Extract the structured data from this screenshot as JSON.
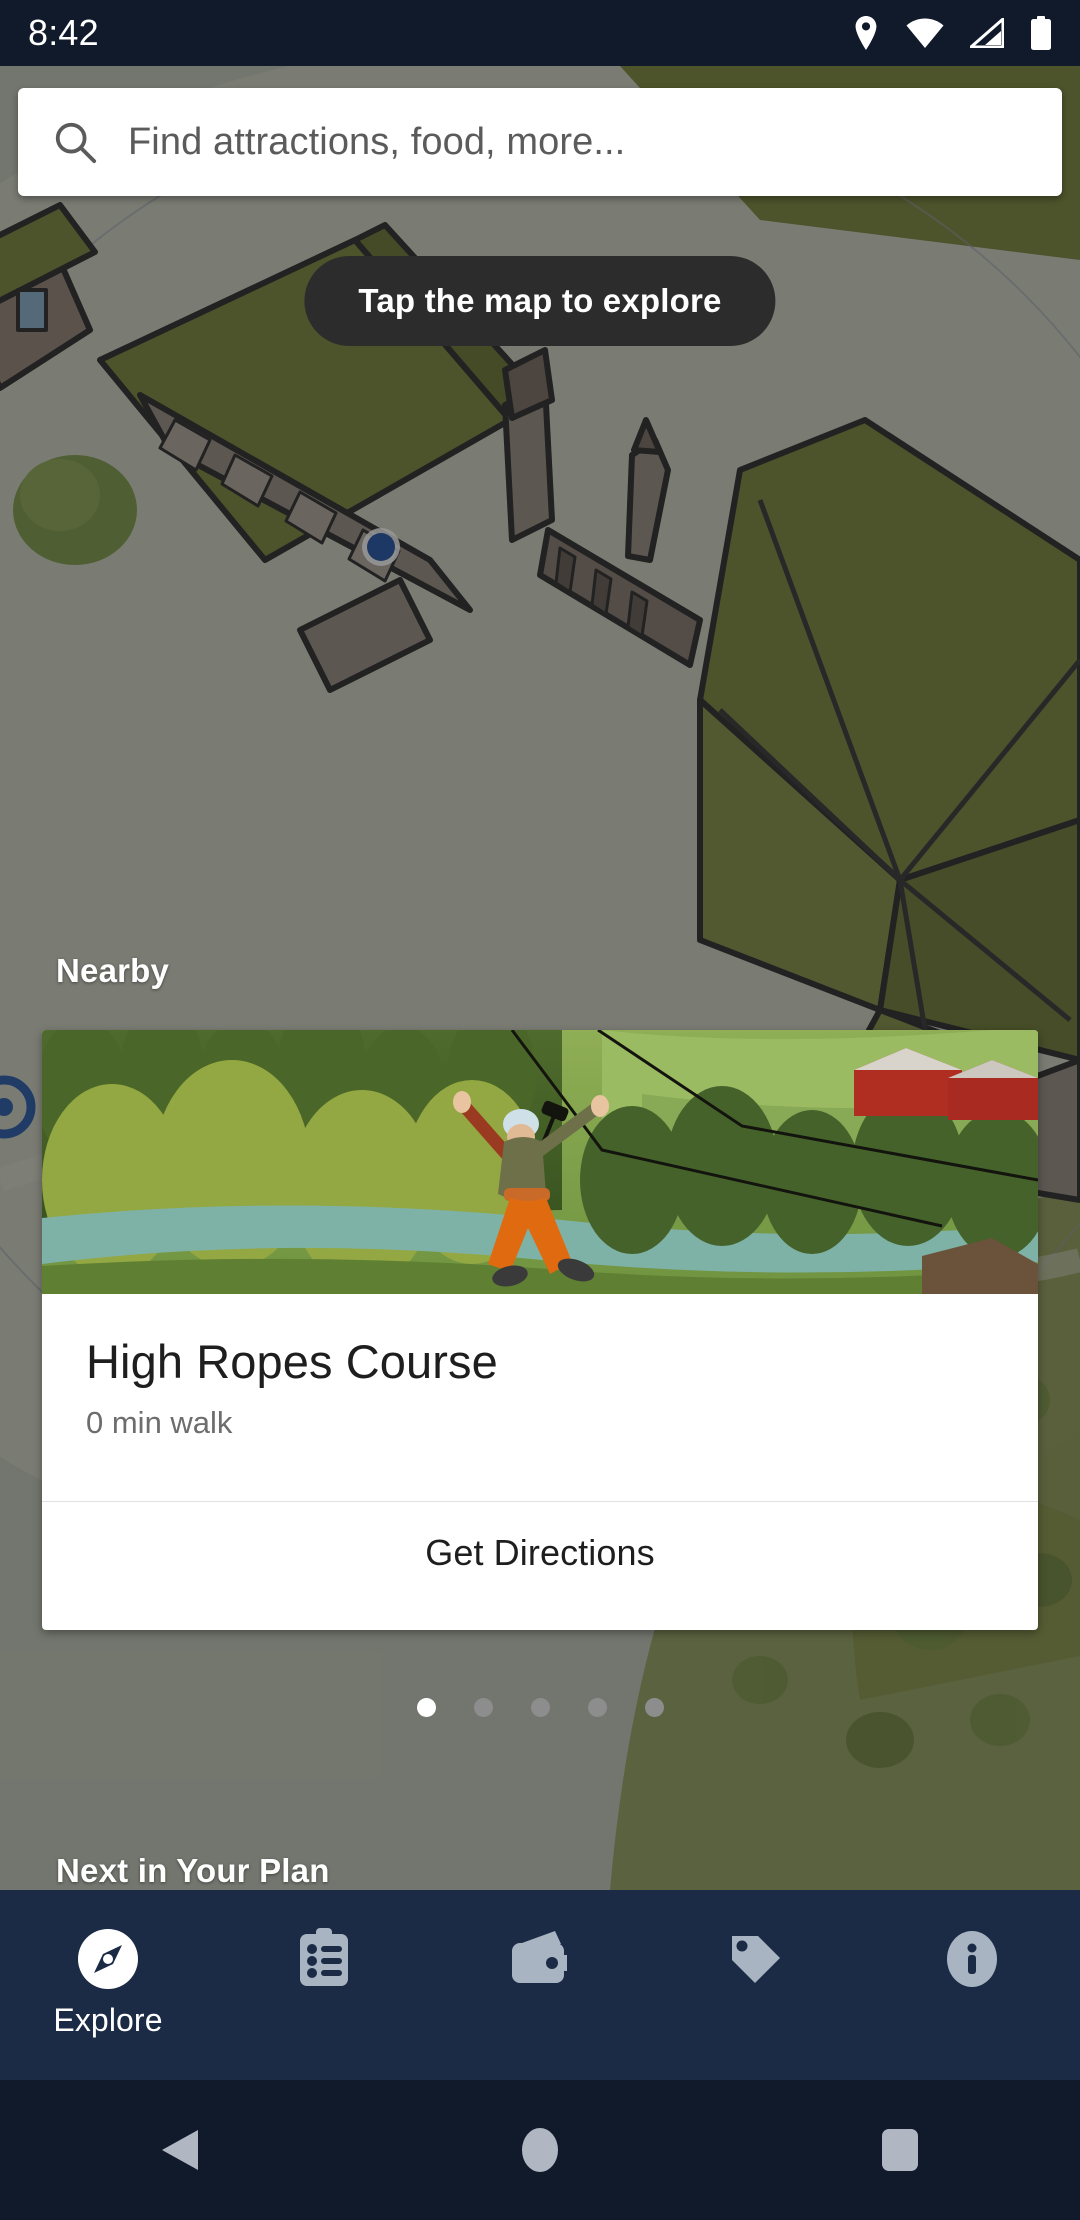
{
  "status_bar": {
    "time": "8:42",
    "icons": [
      {
        "name": "location-icon"
      },
      {
        "name": "wifi-icon"
      },
      {
        "name": "cellular-signal-icon"
      },
      {
        "name": "battery-icon"
      }
    ]
  },
  "search": {
    "icon": "search-icon",
    "placeholder": "Find attractions, food, more...",
    "value": ""
  },
  "map": {
    "toast": "Tap the map to explore",
    "user_location_marker": "blue-location-dot",
    "poi_marker": "blue-circle-marker"
  },
  "nearby": {
    "section_title": "Nearby",
    "card": {
      "image_alt": "zipline-photo",
      "title": "High Ropes Course",
      "subtitle": "0 min walk",
      "action_label": "Get Directions"
    },
    "pagination": {
      "count": 5,
      "active_index": 0
    }
  },
  "next_plan": {
    "section_title": "Next in Your Plan"
  },
  "tab_bar": {
    "items": [
      {
        "label": "Explore",
        "icon": "compass-icon",
        "active": true
      },
      {
        "label": "",
        "icon": "clipboard-list-icon",
        "active": false
      },
      {
        "label": "",
        "icon": "wallet-icon",
        "active": false
      },
      {
        "label": "",
        "icon": "tag-icon",
        "active": false
      },
      {
        "label": "",
        "icon": "info-icon",
        "active": false
      }
    ]
  },
  "android_nav": {
    "buttons": [
      {
        "name": "back-button",
        "icon": "triangle-back-icon"
      },
      {
        "name": "home-button",
        "icon": "circle-home-icon"
      },
      {
        "name": "recents-button",
        "icon": "square-recents-icon"
      }
    ]
  },
  "colors": {
    "status_bar_bg": "#101a2b",
    "tab_bar_bg": "#1b2b45",
    "accent_white": "#ffffff",
    "inactive_icon": "#a9b4c2",
    "toast_bg": "#2c2c2c",
    "card_bg": "#ffffff",
    "map_green": "#6f7c2e",
    "marker_blue": "#1a4fa0"
  }
}
